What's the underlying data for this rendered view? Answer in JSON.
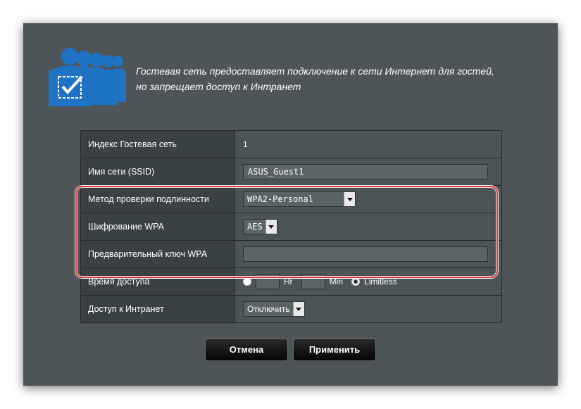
{
  "header": {
    "line1": "Гостевая сеть предоставляет подключение к сети Интернет для гостей,",
    "line2": "но запрещает доступ к Интранет"
  },
  "rows": {
    "index": {
      "label": "Индекс Гостевая сеть",
      "value": "1"
    },
    "ssid": {
      "label": "Имя сети (SSID)",
      "value": "ASUS_Guest1"
    },
    "auth": {
      "label": "Метод проверки подлинности",
      "value": "WPA2-Personal"
    },
    "encryption": {
      "label": "Шифрование WPA",
      "value": "AES"
    },
    "psk": {
      "label": "Предварительный ключ WPA",
      "value": ""
    },
    "access_time": {
      "label": "Время доступа",
      "hr_unit": "Hr",
      "min_unit": "Min",
      "limitless": "Limitless"
    },
    "intranet": {
      "label": "Доступ к Интранет",
      "value": "Отключить"
    }
  },
  "buttons": {
    "cancel": "Отмена",
    "apply": "Применить"
  },
  "colors": {
    "panel": "#4d5558",
    "label_cell": "#3a4144",
    "highlight": "#d93a3a",
    "icon_blue": "#1f73c5"
  }
}
